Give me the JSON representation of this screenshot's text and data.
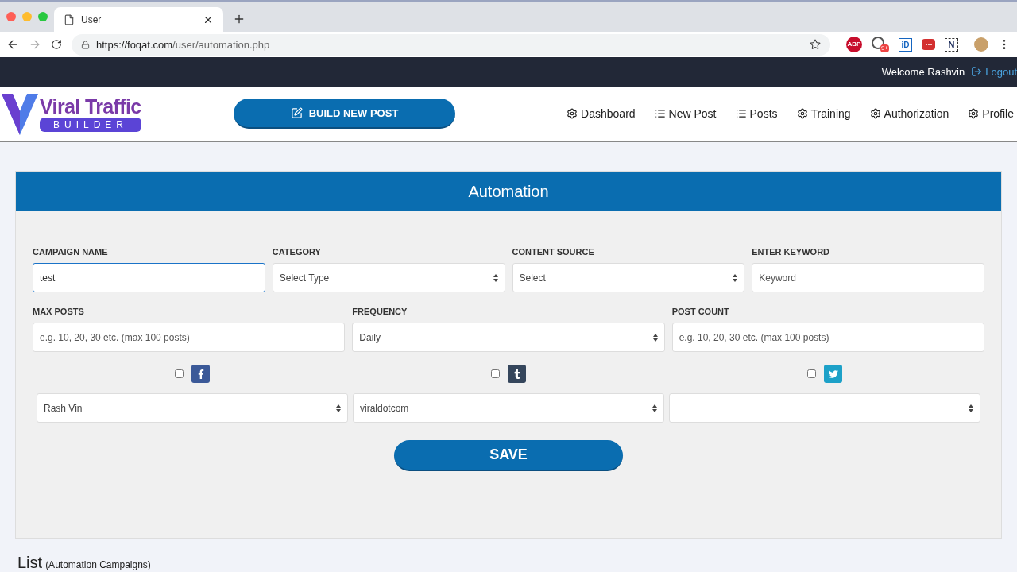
{
  "browser": {
    "tab_title": "User",
    "url_host": "https://foqat.com",
    "url_path": "/user/automation.php",
    "extensions": [
      {
        "kind": "abp",
        "label": "ABP"
      },
      {
        "kind": "badge",
        "label": "9+"
      },
      {
        "kind": "id",
        "label": "iD"
      },
      {
        "kind": "dots"
      },
      {
        "kind": "n",
        "label": "N"
      }
    ]
  },
  "topbar": {
    "welcome": "Welcome Rashvin",
    "logout": "Logout"
  },
  "header": {
    "logo_title": "Viral Traffic",
    "logo_subtitle": "BUILDER",
    "build_button": "BUILD NEW POST",
    "nav": [
      {
        "label": "Dashboard",
        "kind": "gear"
      },
      {
        "label": "New Post",
        "kind": "list"
      },
      {
        "label": "Posts",
        "kind": "list"
      },
      {
        "label": "Training",
        "kind": "gear"
      },
      {
        "label": "Authorization",
        "kind": "gear"
      },
      {
        "label": "Profile",
        "kind": "gear"
      }
    ]
  },
  "panel": {
    "title": "Automation",
    "row1": [
      {
        "label": "CAMPAIGN NAME",
        "kind": "text",
        "value": "test",
        "focused": true
      },
      {
        "label": "CATEGORY",
        "kind": "select",
        "value": "Select Type",
        "focused": false
      },
      {
        "label": "CONTENT SOURCE",
        "kind": "select",
        "value": "Select",
        "focused": false
      },
      {
        "label": "ENTER KEYWORD",
        "kind": "text",
        "placeholder": "Keyword",
        "focused": false
      }
    ],
    "row2": [
      {
        "label": "MAX POSTS",
        "kind": "text",
        "placeholder": "e.g. 10, 20, 30 etc. (max 100 posts)",
        "focused": false
      },
      {
        "label": "FREQUENCY",
        "kind": "select",
        "value": "Daily",
        "focused": false
      },
      {
        "label": "POST COUNT",
        "kind": "text",
        "placeholder": "e.g. 10, 20, 30 etc. (max 100 posts)",
        "focused": false
      }
    ],
    "networks": [
      {
        "kind": "facebook",
        "checked": false,
        "account": "Rash Vin"
      },
      {
        "kind": "tumblr",
        "checked": false,
        "account": "viraldotcom"
      },
      {
        "kind": "twitter",
        "checked": false
      }
    ],
    "save_button": "SAVE"
  },
  "list": {
    "title": "List",
    "subtitle": "(Automation Campaigns)"
  }
}
